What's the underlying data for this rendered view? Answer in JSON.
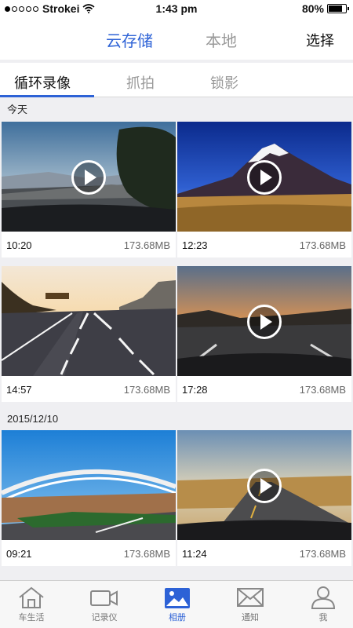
{
  "status": {
    "carrier": "Strokei",
    "time": "1:43 pm",
    "battery": "80%",
    "battery_level": 0.8
  },
  "nav": {
    "segments": [
      "云存储",
      "本地"
    ],
    "active_segment": "云存储",
    "select_label": "选择"
  },
  "tabs": {
    "items": [
      "循环录像",
      "抓拍",
      "锁影"
    ],
    "active": "循环录像"
  },
  "sections": [
    {
      "label": "今天",
      "videos": [
        {
          "time": "10:20",
          "size": "173.68MB"
        },
        {
          "time": "12:23",
          "size": "173.68MB"
        },
        {
          "time": "14:57",
          "size": "173.68MB"
        },
        {
          "time": "17:28",
          "size": "173.68MB"
        }
      ]
    },
    {
      "label": "2015/12/10",
      "videos": [
        {
          "time": "09:21",
          "size": "173.68MB"
        },
        {
          "time": "11:24",
          "size": "173.68MB"
        }
      ]
    }
  ],
  "tabbar": {
    "items": [
      "车生活",
      "记录仪",
      "相册",
      "通知",
      "我"
    ],
    "active": "相册"
  },
  "colors": {
    "accent": "#2d62d6",
    "inactive": "#999999"
  }
}
